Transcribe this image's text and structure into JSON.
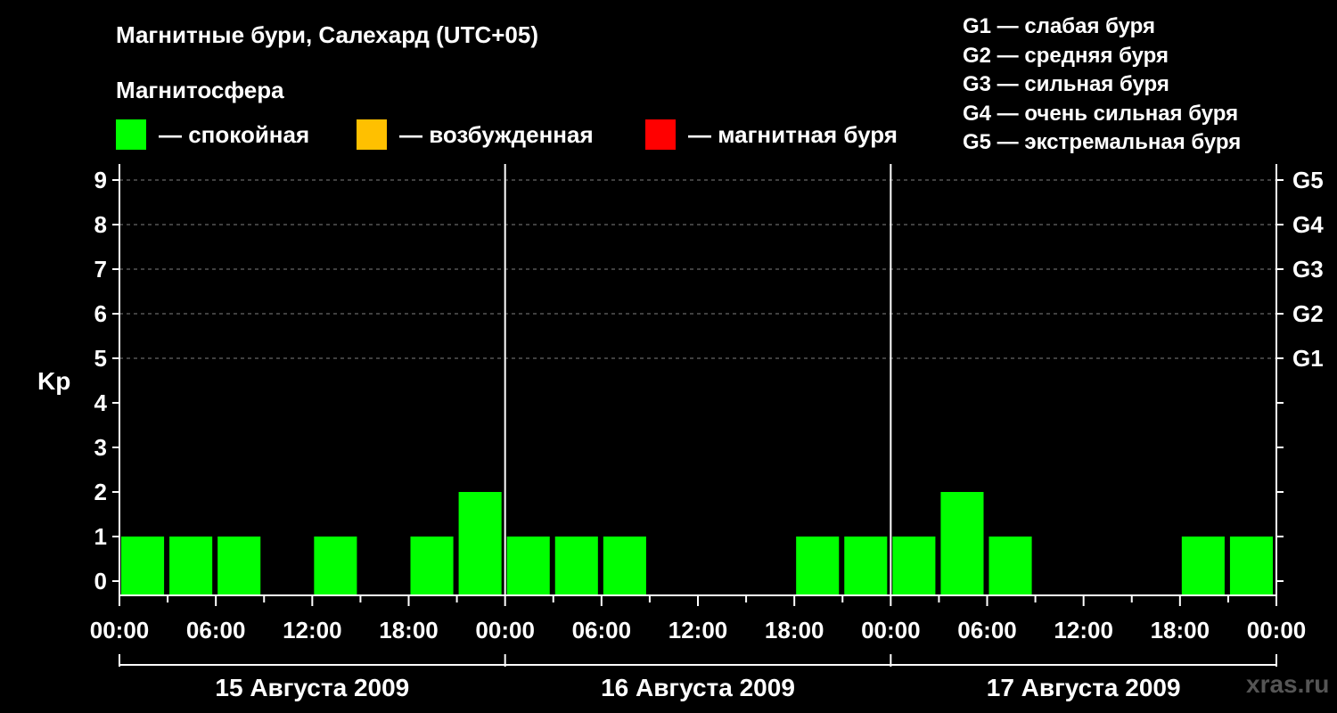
{
  "header": {
    "title": "Магнитные бури, Салехард (UTC+05)",
    "subtitle": "Магнитосфера"
  },
  "legend": [
    {
      "label": "— спокойная",
      "color": "#00ff00"
    },
    {
      "label": "— возбужденная",
      "color": "#ffc000"
    },
    {
      "label": "— магнитная буря",
      "color": "#ff0000"
    }
  ],
  "g_legend": [
    "G1 — слабая буря",
    "G2 — средняя буря",
    "G3 — сильная буря",
    "G4 — очень сильная буря",
    "G5 — экстремальная буря"
  ],
  "watermark": "xras.ru",
  "chart_data": {
    "type": "bar",
    "ylabel": "Kp",
    "ylim": [
      0,
      9
    ],
    "yticks": [
      "0",
      "1",
      "2",
      "3",
      "4",
      "5",
      "6",
      "7",
      "8",
      "9"
    ],
    "g_levels": [
      {
        "kp": 5,
        "label": "G1"
      },
      {
        "kp": 6,
        "label": "G2"
      },
      {
        "kp": 7,
        "label": "G3"
      },
      {
        "kp": 8,
        "label": "G4"
      },
      {
        "kp": 9,
        "label": "G5"
      }
    ],
    "x_tick_labels": [
      "00:00",
      "06:00",
      "12:00",
      "18:00",
      "00:00",
      "06:00",
      "12:00",
      "18:00",
      "00:00",
      "06:00",
      "12:00",
      "18:00",
      "00:00"
    ],
    "days": [
      "15 Августа 2009",
      "16 Августа 2009",
      "17 Августа 2009"
    ],
    "interval_hours": 3,
    "values": [
      1,
      1,
      1,
      0,
      1,
      0,
      1,
      2,
      1,
      1,
      1,
      0,
      0,
      0,
      1,
      1,
      1,
      2,
      1,
      0,
      0,
      0,
      1,
      1
    ],
    "bar_color": "#00ff00",
    "grid": "dashed at 5-9"
  }
}
